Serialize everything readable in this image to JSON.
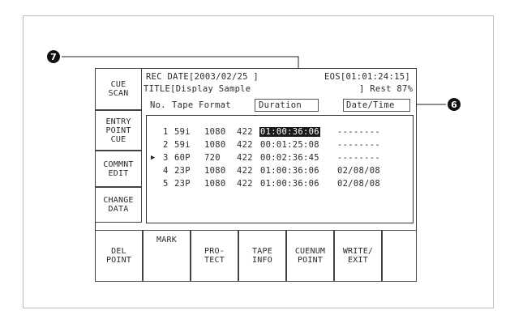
{
  "left_buttons": [
    {
      "label": "CUE\nSCAN"
    },
    {
      "label": "ENTRY\nPOINT\nCUE"
    },
    {
      "label": "COMMNT\nEDIT"
    },
    {
      "label": "CHANGE\nDATA"
    }
  ],
  "header": {
    "rec_date": "REC DATE[2003/02/25 ]",
    "eos": "EOS[01:01:24:15]",
    "title": "TITLE[Display Sample",
    "rest": "] Rest 87%"
  },
  "columns": {
    "no": "No.",
    "tape_format": "Tape Format",
    "duration": "Duration",
    "date_time": "Date/Time"
  },
  "rows": [
    {
      "no": "1",
      "fmt": "59i",
      "res": "1080",
      "sub": "422",
      "duration": "01:00:36:06",
      "date": "--------",
      "cursor": "",
      "selected": true
    },
    {
      "no": "2",
      "fmt": "59i",
      "res": "1080",
      "sub": "422",
      "duration": "00:01:25:08",
      "date": "--------",
      "cursor": "",
      "selected": false
    },
    {
      "no": "3",
      "fmt": "60P",
      "res": "720",
      "sub": "422",
      "duration": "00:02:36:45",
      "date": "--------",
      "cursor": "▶",
      "selected": false
    },
    {
      "no": "4",
      "fmt": "23P",
      "res": "1080",
      "sub": "422",
      "duration": "01:00:36:06",
      "date": "02/08/08",
      "cursor": "",
      "selected": false
    },
    {
      "no": "5",
      "fmt": "23P",
      "res": "1080",
      "sub": "422",
      "duration": "01:00:36:06",
      "date": "02/08/08",
      "cursor": "",
      "selected": false
    }
  ],
  "bottom_buttons": [
    {
      "label": "DEL\nPOINT"
    },
    {
      "label": "MARK"
    },
    {
      "label": "PRO-\nTECT"
    },
    {
      "label": "TAPE\nINFO"
    },
    {
      "label": "CUENUM\nPOINT"
    },
    {
      "label": "WRITE/\nEXIT"
    },
    {
      "label": ""
    }
  ],
  "callouts": {
    "seven": "7",
    "six": "6"
  }
}
